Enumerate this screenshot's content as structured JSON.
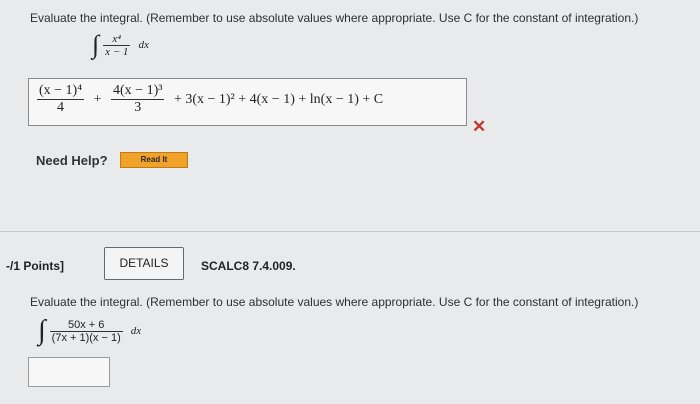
{
  "question1": {
    "prompt": "Evaluate the integral. (Remember to use absolute values where appropriate. Use C for the constant of integration.)",
    "integral": {
      "sign": "∫",
      "numerator": "x⁴",
      "denominator": "x − 1",
      "dx": "dx"
    },
    "answer": {
      "term1_num": "(x − 1)⁴",
      "term1_den": "4",
      "plus": "+",
      "term2_num": "4(x − 1)³",
      "term2_den": "3",
      "rest": "+ 3(x − 1)² + 4(x − 1) + ln(x − 1) + C"
    },
    "status_icon": "wrong-x-icon",
    "status_mark": "✕",
    "help_label": "Need Help?",
    "read_button": "Read It"
  },
  "question2": {
    "points": "-/1 Points]",
    "details_button": "DETAILS",
    "problem_id": "SCALC8 7.4.009.",
    "prompt": "Evaluate the integral. (Remember to use absolute values where appropriate. Use C for the constant of integration.)",
    "integral": {
      "sign": "∫",
      "numerator": "50x + 6",
      "denominator": "(7x + 1)(x − 1)",
      "dx": "dx"
    }
  },
  "colors": {
    "background": "#e9eaec",
    "read_button": "#f0a22b",
    "wrong_mark": "#c0392b"
  }
}
